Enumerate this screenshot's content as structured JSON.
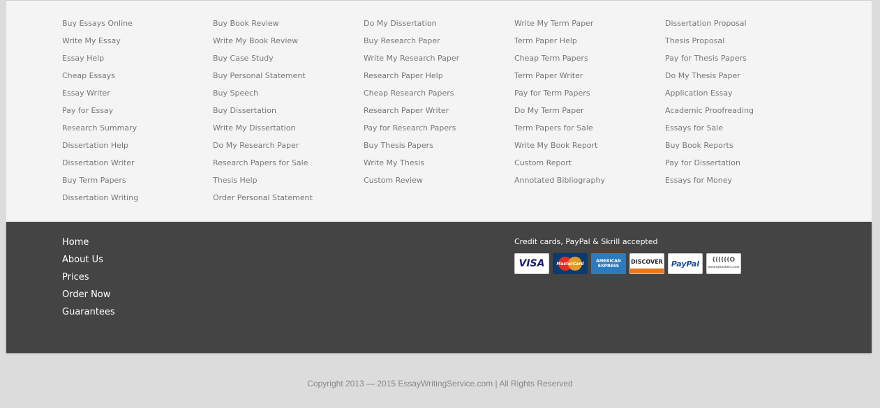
{
  "footer_links": {
    "columns": [
      [
        "Buy Essays Online",
        "Write My Essay",
        "Essay Help",
        "Cheap Essays",
        "Essay Writer",
        "Pay for Essay",
        "Research Summary",
        "Dissertation Help",
        "Dissertation Writer",
        "Buy Term Papers",
        "Dissertation Writing"
      ],
      [
        "Buy Book Review",
        "Write My Book Review",
        "Buy Case Study",
        "Buy Personal Statement",
        "Buy Speech",
        "Buy Dissertation",
        "Write My Dissertation",
        "Do My Research Paper",
        "Research Papers for Sale",
        "Thesis Help",
        "Order Personal Statement"
      ],
      [
        "Do My Dissertation",
        "Buy Research Paper",
        "Write My Research Paper",
        "Research Paper Help",
        "Cheap Research Papers",
        "Research Paper Writer",
        "Pay for Research Papers",
        "Buy Thesis Papers",
        "Write My Thesis",
        "Custom Review"
      ],
      [
        "Write My Term Paper",
        "Term Paper Help",
        "Cheap Term Papers",
        "Term Paper Writer",
        "Pay for Term Papers",
        "Do My Term Paper",
        "Term Papers for Sale",
        "Write My Book Report",
        "Custom Report",
        "Annotated Bibliography"
      ],
      [
        "Dissertation Proposal",
        "Thesis Proposal",
        "Pay for Thesis Papers",
        "Do My Thesis Paper",
        "Application Essay",
        "Academic Proofreading",
        "Essays for Sale",
        "Buy Book Reports",
        "Pay for Dissertation",
        "Essays for Money"
      ]
    ]
  },
  "nav": {
    "items": [
      "Home",
      "About Us",
      "Prices",
      "Order Now",
      "Guarantees"
    ]
  },
  "payment": {
    "text": "Credit cards, PayPal & Skrill accepted",
    "cards": {
      "visa": "VISA",
      "mastercard": "MasterCard",
      "amex_line1": "AMERICAN",
      "amex_line2": "EXPRESS",
      "discover": "DISCOVER",
      "paypal": "PayPal",
      "skrill": "((((((O",
      "skrill_sub": "oneasybookers.com"
    }
  },
  "copyright": "Copyright 2013 — 2015 EssayWritingService.com | All Rights Reserved",
  "colors": {
    "page_bg": "#dcdcdc",
    "links_bg": "#f4f4f4",
    "dark_bg": "#444444",
    "link_text": "#777777"
  }
}
